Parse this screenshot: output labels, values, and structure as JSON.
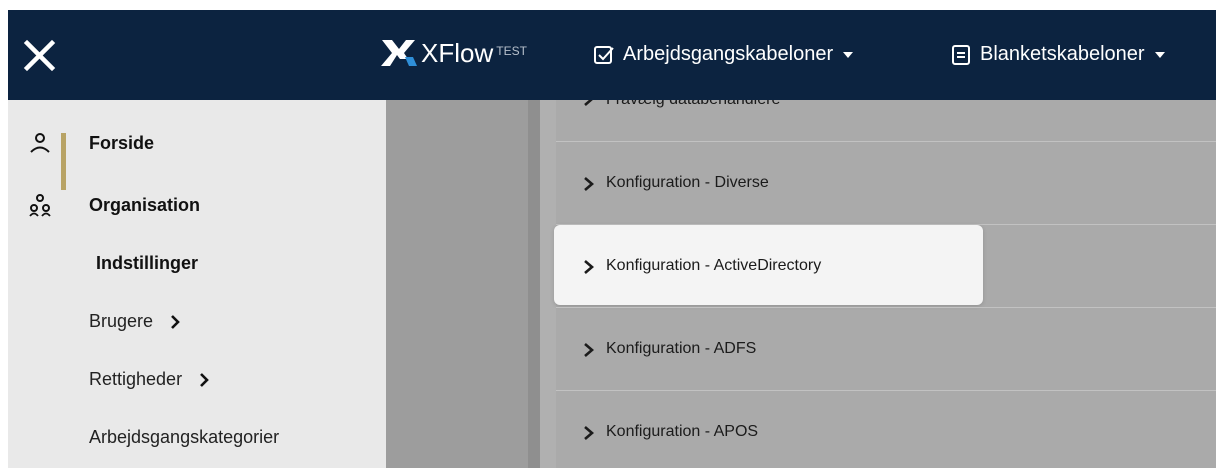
{
  "app": {
    "logo_text": "XFlow",
    "env_badge": "TEST"
  },
  "topnav": [
    {
      "label": "Arbejdsgangskabeloner",
      "icon": "checkbox-icon"
    },
    {
      "label": "Blanketskabeloner",
      "icon": "document-icon"
    }
  ],
  "sidebar": {
    "items": [
      {
        "label": "Forside",
        "icon": "person-icon"
      },
      {
        "label": "Organisation",
        "icon": "org-icon"
      },
      {
        "label": "Indstillinger"
      },
      {
        "label": "Brugere"
      },
      {
        "label": "Rettigheder"
      },
      {
        "label": "Arbejdsgangskategorier"
      }
    ]
  },
  "main": {
    "rows": [
      {
        "label": "Fravælg databehandlere"
      },
      {
        "label": "Konfiguration - Diverse"
      },
      {
        "label": "Konfiguration - ActiveDirectory"
      },
      {
        "label": "Konfiguration - ADFS"
      },
      {
        "label": "Konfiguration - APOS"
      }
    ]
  },
  "colors": {
    "topbar": "#0c2340",
    "accent": "#b8a365",
    "logo_blue": "#2f8fd8"
  }
}
